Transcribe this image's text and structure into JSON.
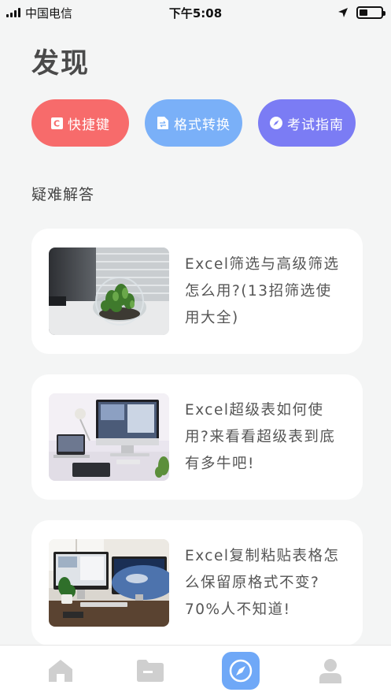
{
  "status_bar": {
    "carrier": "中国电信",
    "time": "下午5:08"
  },
  "page": {
    "title": "发现"
  },
  "quick_actions": [
    {
      "label": "快捷键",
      "icon": "c-key-icon",
      "color": "#f76b6b"
    },
    {
      "label": "格式转换",
      "icon": "file-convert-icon",
      "color": "#7ab0f8"
    },
    {
      "label": "考试指南",
      "icon": "compass-icon",
      "color": "#7b7cf4"
    }
  ],
  "faq": {
    "title": "疑难解答",
    "articles": [
      {
        "title": "Excel筛选与高级筛选怎么用?(13招筛选使用大全)",
        "image": "desk-terrarium-photo"
      },
      {
        "title": "Excel超级表如何使用?来看看超级表到底有多牛吧!",
        "image": "imac-desk-photo"
      },
      {
        "title": "Excel复制粘贴表格怎么保留原格式不变?70%人不知道!",
        "image": "dual-monitor-photo"
      }
    ]
  },
  "tab_bar": {
    "tabs": [
      {
        "icon": "home-icon",
        "active": false
      },
      {
        "icon": "folder-icon",
        "active": false
      },
      {
        "icon": "compass-icon",
        "active": true,
        "color": "#6fa8f7"
      },
      {
        "icon": "person-icon",
        "active": false
      }
    ]
  }
}
